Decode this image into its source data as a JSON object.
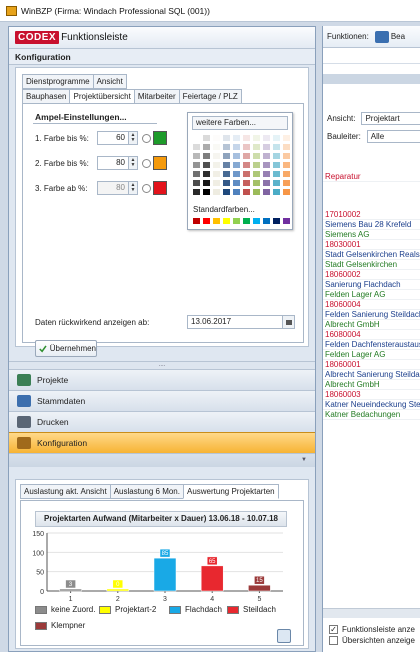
{
  "window": {
    "title": "WinBZP (Firma: Windach Professional SQL  (001))"
  },
  "left": {
    "header": {
      "logo_text": "CODEX",
      "logo_suffix": "Funktionsleiste"
    },
    "section_title": "Konfiguration",
    "tabs_row1": [
      "Dienstprogramme",
      "Ansicht"
    ],
    "tabs_row2": [
      "Bauphasen",
      "Projektübersicht",
      "Mitarbeiter",
      "Feiertage / PLZ"
    ],
    "active_tab": "Projektübersicht",
    "ampel": {
      "title": "Ampel-Einstellungen...",
      "rows": [
        {
          "label": "1. Farbe bis %:",
          "value": "60",
          "color": "#1e9b2a",
          "disabled": false
        },
        {
          "label": "2. Farbe bis %:",
          "value": "80",
          "color": "#f59a0c",
          "disabled": false
        },
        {
          "label": "3. Farbe ab %:",
          "value": "80",
          "color": "#e3131b",
          "disabled": true
        }
      ]
    },
    "palette": {
      "more_colors": "weitere Farben...",
      "standard_colors_label": "Standardfarben...",
      "standard_colors": [
        "#c00000",
        "#ff0000",
        "#ffc000",
        "#ffff00",
        "#92d050",
        "#00b050",
        "#00b0f0",
        "#0070c0",
        "#002060",
        "#7030a0"
      ]
    },
    "daten": {
      "label": "Daten rückwirkend anzeigen ab:",
      "date": "13.06.2017"
    },
    "apply_button": "Übernehmen",
    "nav": [
      {
        "label": "Projekte",
        "icon": "projects-icon",
        "color": "#3b7f55"
      },
      {
        "label": "Stammdaten",
        "icon": "stammdaten-icon",
        "color": "#3d6fae"
      },
      {
        "label": "Drucken",
        "icon": "printer-icon",
        "color": "#5a6675"
      },
      {
        "label": "Konfiguration",
        "icon": "wrench-icon",
        "color": "#a06a1b"
      }
    ],
    "auslastung_tabs": [
      "Auslastung akt. Ansicht",
      "Auslastung 6 Mon.",
      "Auswertung Projektarten"
    ],
    "legend": [
      {
        "label": "keine Zuord.",
        "color": "#8c8c8c"
      },
      {
        "label": "Projektart-2",
        "color": "#ffff00"
      },
      {
        "label": "Flachdach",
        "color": "#19a9e6"
      },
      {
        "label": "Steildach",
        "color": "#e8282f"
      },
      {
        "label": "Klempner",
        "color": "#9b3a3a"
      }
    ]
  },
  "chart_data": {
    "type": "bar",
    "title": "Projektarten Aufwand (Mitarbeiter x Dauer) 13.06.18 - 10.07.18",
    "categories": [
      "1",
      "2",
      "3",
      "4",
      "5"
    ],
    "ylim": [
      0,
      150
    ],
    "yticks": [
      0,
      50,
      100,
      150
    ],
    "series": [
      {
        "name": "keine Zuord.",
        "color": "#8c8c8c",
        "values": [
          3,
          0,
          0,
          0,
          0
        ]
      },
      {
        "name": "Projektart-2",
        "color": "#ffff00",
        "values": [
          0,
          0,
          0,
          0,
          0
        ]
      },
      {
        "name": "Flachdach",
        "color": "#19a9e6",
        "values": [
          0,
          0,
          85,
          0,
          0
        ]
      },
      {
        "name": "Steildach",
        "color": "#e8282f",
        "values": [
          0,
          0,
          0,
          65,
          0
        ]
      },
      {
        "name": "Klempner",
        "color": "#9b3a3a",
        "values": [
          0,
          0,
          0,
          0,
          15
        ]
      }
    ],
    "grid": true
  },
  "right": {
    "functions_label": "Funktionen:",
    "functions_suffix": "Bea",
    "view_label": "Ansicht:",
    "view_value": "Projektart",
    "site_label": "Bauleiter:",
    "site_value": "Alle",
    "list": [
      {
        "text": "Reparatur",
        "kind": "red"
      },
      {
        "text": "17010002",
        "kind": "num"
      },
      {
        "text": "Siemens Bau 28 Krefeld",
        "kind": "title"
      },
      {
        "text": "Siemens AG",
        "kind": "firm"
      },
      {
        "text": "18030001",
        "kind": "num"
      },
      {
        "text": "Stadt Gelsenkirchen Realsch",
        "kind": "title"
      },
      {
        "text": "Stadt Gelsenkirchen",
        "kind": "firm"
      },
      {
        "text": "18060002",
        "kind": "num"
      },
      {
        "text": "Sanierung Flachdach",
        "kind": "title"
      },
      {
        "text": "Felden Lager AG",
        "kind": "firm"
      },
      {
        "text": "18060004",
        "kind": "num"
      },
      {
        "text": "Felden Sanierung Steildach",
        "kind": "title"
      },
      {
        "text": "Albrecht GmbH",
        "kind": "firm"
      },
      {
        "text": "16080004",
        "kind": "num"
      },
      {
        "text": "Felden Dachfensteraustausc",
        "kind": "title"
      },
      {
        "text": "Felden Lager AG",
        "kind": "firm"
      },
      {
        "text": "18060001",
        "kind": "num"
      },
      {
        "text": "Albrecht Sanierung Steildac",
        "kind": "title"
      },
      {
        "text": "Albrecht GmbH",
        "kind": "firm"
      },
      {
        "text": "18060003",
        "kind": "num"
      },
      {
        "text": "Katner Neueindeckung Steil",
        "kind": "title"
      },
      {
        "text": "Katner Bedachungen",
        "kind": "firm"
      }
    ],
    "checkboxes": [
      {
        "label": "Funktionsleiste anze",
        "checked": true
      },
      {
        "label": "Übersichten anzeige",
        "checked": false
      }
    ]
  }
}
